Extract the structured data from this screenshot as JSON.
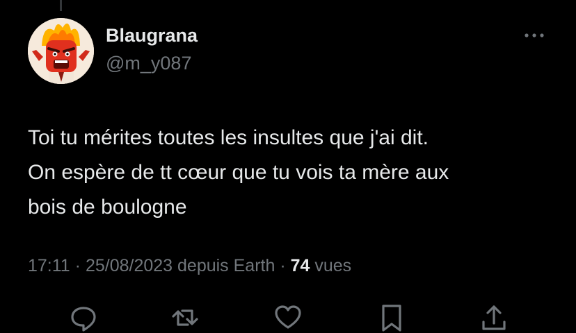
{
  "tweet": {
    "display_name": "Blaugrana",
    "handle": "@m_y087",
    "text_lines": [
      "Toi tu mérites toutes les insultes que j'ai dit.",
      "On espère de tt cœur que tu vois ta mère aux",
      "bois de boulogne"
    ],
    "time": "17:11",
    "date": "25/08/2023",
    "source": "depuis Earth",
    "separator": " · ",
    "views_count": "74",
    "views_label": "vues"
  },
  "icons": {
    "more": "more-horizontal-icon",
    "reply": "reply-icon",
    "retweet": "retweet-icon",
    "like": "heart-icon",
    "bookmark": "bookmark-icon",
    "share": "share-icon"
  },
  "colors": {
    "background": "#000000",
    "primary_text": "#e7e9ea",
    "secondary_text": "#71767b",
    "avatar_red": "#e0301e",
    "avatar_flame": "#ffb300"
  }
}
